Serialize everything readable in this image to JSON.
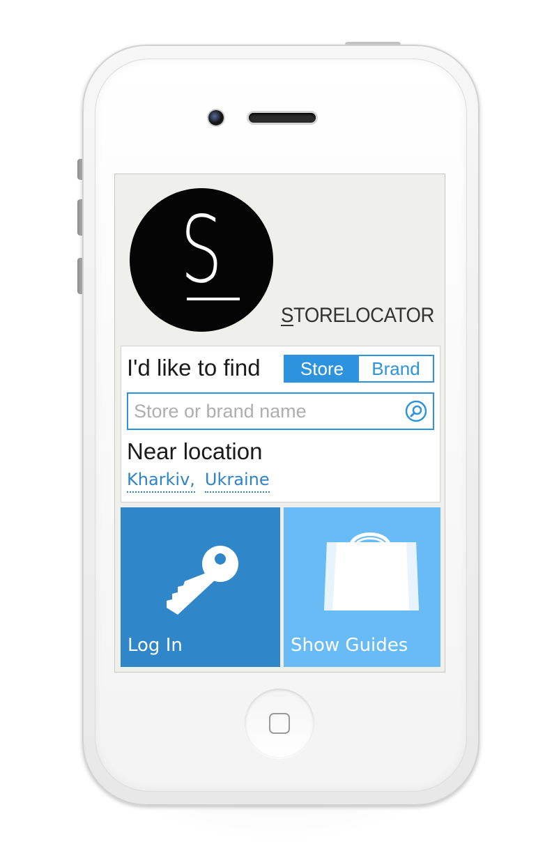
{
  "app": {
    "logo_letter": "S",
    "brand_first_letter": "S",
    "brand_rest": "TORELOCATOR"
  },
  "search": {
    "find_label": "I'd like to find",
    "toggle": {
      "options": [
        "Store",
        "Brand"
      ],
      "selected": "Store"
    },
    "placeholder": "Store or brand name",
    "value": "",
    "near_label": "Near location",
    "location": {
      "city": "Kharkiv,",
      "country": "Ukraine"
    }
  },
  "tiles": {
    "login": {
      "label": "Log In",
      "icon": "key-icon"
    },
    "guides": {
      "label": "Show Guides",
      "icon": "shopping-bag-icon"
    }
  },
  "colors": {
    "accent": "#2d93de",
    "login_tile": "#2f86c8",
    "guides_tile": "#68bbf5",
    "screen_bg": "#efefec"
  }
}
